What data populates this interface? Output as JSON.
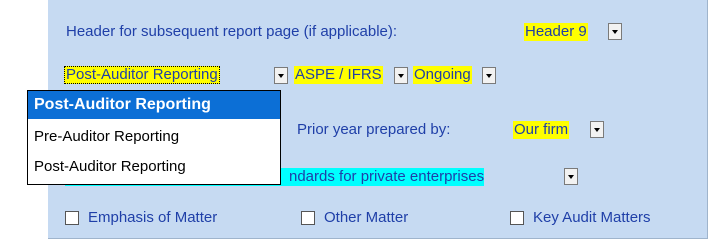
{
  "header_row": {
    "label": "Header for subsequent report page (if applicable):",
    "value": "Header 9"
  },
  "report_row": {
    "reporting_value": "Post-Auditor Reporting",
    "framework_value": "ASPE / IFRS",
    "status_value": "Ongoing"
  },
  "prior_year_row": {
    "label": "Prior year prepared by:",
    "value": "Our firm"
  },
  "standards_row": {
    "value_visible": "ndards for private enterprises"
  },
  "checkboxes": [
    {
      "label": "Emphasis of Matter",
      "checked": false
    },
    {
      "label": "Other Matter",
      "checked": false
    },
    {
      "label": "Key Audit Matters",
      "checked": false
    }
  ],
  "dropdown_popup": {
    "options": [
      "Post-Auditor Reporting",
      "Pre-Auditor Reporting",
      "Post-Auditor Reporting"
    ],
    "selected_index": 0
  },
  "colors": {
    "panel_bg": "#c6daf2",
    "label_text": "#1f3fa8",
    "highlight_yellow": "#ffff00",
    "highlight_cyan": "#00ffff",
    "selection_blue": "#0c6fd6"
  }
}
